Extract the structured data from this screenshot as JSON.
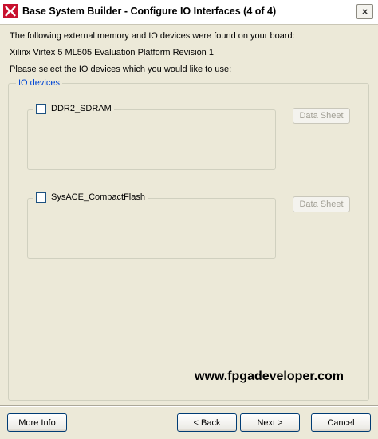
{
  "window": {
    "title": "Base System Builder - Configure IO Interfaces (4 of 4)",
    "app_icon": "xilinx-logo-icon",
    "close_symbol": "×"
  },
  "body": {
    "intro": "The following external memory and IO devices were found on your board:",
    "board": "Xilinx Virtex 5 ML505 Evaluation Platform Revision 1",
    "instruction": "Please select the IO devices which you would like to use:"
  },
  "group": {
    "label": "IO devices",
    "devices": [
      {
        "name": "DDR2_SDRAM",
        "checked": false,
        "datasheet_label": "Data Sheet",
        "datasheet_enabled": false
      },
      {
        "name": "SysACE_CompactFlash",
        "checked": false,
        "datasheet_label": "Data Sheet",
        "datasheet_enabled": false
      }
    ]
  },
  "watermark": "www.fpgadeveloper.com",
  "buttons": {
    "more_info": "More Info",
    "back": "< Back",
    "next": "Next >",
    "cancel": "Cancel"
  },
  "colors": {
    "dialog_bg": "#ece9d8",
    "group_label": "#0046d5",
    "disabled_text": "#a19f94",
    "button_border": "#003c74"
  }
}
